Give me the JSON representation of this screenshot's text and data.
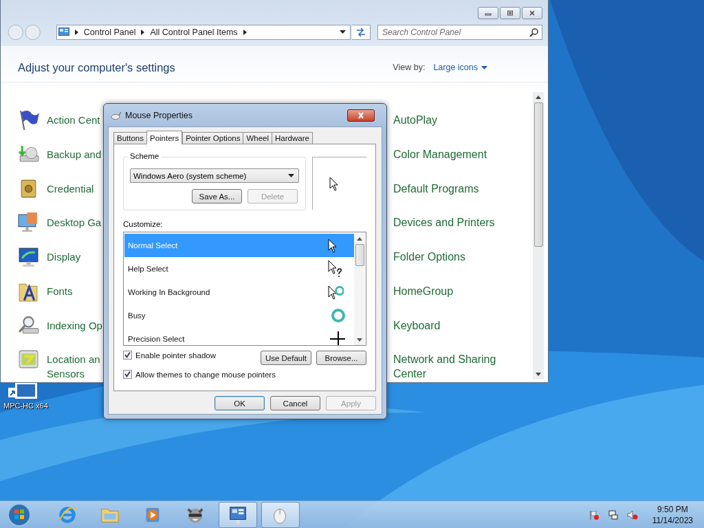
{
  "control_panel": {
    "breadcrumb": [
      "Control Panel",
      "All Control Panel Items"
    ],
    "search": {
      "placeholder": "Search Control Panel"
    },
    "heading": "Adjust your computer's settings",
    "view_by": {
      "label": "View by:",
      "value": "Large icons"
    },
    "items_left": [
      {
        "lines": [
          "Action Cent"
        ]
      },
      {
        "lines": [
          "Backup and"
        ]
      },
      {
        "lines": [
          "Credential"
        ]
      },
      {
        "lines": [
          "Desktop Ga"
        ]
      },
      {
        "lines": [
          "Display"
        ]
      },
      {
        "lines": [
          "Fonts"
        ]
      },
      {
        "lines": [
          "Indexing Op"
        ]
      },
      {
        "lines": [
          "Location an",
          "Sensors"
        ]
      }
    ],
    "items_right": [
      {
        "lines": [
          "AutoPlay"
        ]
      },
      {
        "lines": [
          "Color Management"
        ]
      },
      {
        "lines": [
          "Default Programs"
        ]
      },
      {
        "lines": [
          "Devices and Printers"
        ]
      },
      {
        "lines": [
          "Folder Options"
        ]
      },
      {
        "lines": [
          "HomeGroup"
        ]
      },
      {
        "lines": [
          "Keyboard"
        ]
      },
      {
        "lines": [
          "Network and Sharing",
          "Center"
        ]
      }
    ]
  },
  "desktop_icons": [
    {
      "label": "MPC-HC x64"
    }
  ],
  "dialog": {
    "title": "Mouse Properties",
    "tabs": [
      {
        "label": "Buttons",
        "selected": false
      },
      {
        "label": "Pointers",
        "selected": true
      },
      {
        "label": "Pointer Options",
        "selected": false
      },
      {
        "label": "Wheel",
        "selected": false
      },
      {
        "label": "Hardware",
        "selected": false
      }
    ],
    "scheme": {
      "label": "Scheme",
      "value": "Windows Aero (system scheme)",
      "buttons": [
        {
          "label": "Save As...",
          "disabled": false
        },
        {
          "label": "Delete",
          "disabled": true
        }
      ]
    },
    "customize_label": "Customize:",
    "pointers": [
      {
        "name": "Normal Select",
        "kind": "arrow",
        "selected": true
      },
      {
        "name": "Help Select",
        "kind": "help",
        "selected": false
      },
      {
        "name": "Working In Background",
        "kind": "working",
        "selected": false
      },
      {
        "name": "Busy",
        "kind": "busy",
        "selected": false
      },
      {
        "name": "Precision Select",
        "kind": "cross",
        "selected": false
      }
    ],
    "checkboxes": [
      {
        "label": "Enable pointer shadow",
        "checked": true
      },
      {
        "label": "Allow themes to change mouse pointers",
        "checked": true
      }
    ],
    "list_buttons": [
      "Use Default",
      "Browse..."
    ],
    "footer_buttons": [
      {
        "label": "OK",
        "default": true,
        "disabled": false
      },
      {
        "label": "Cancel",
        "default": false,
        "disabled": false
      },
      {
        "label": "Apply",
        "default": false,
        "disabled": true
      }
    ]
  },
  "taskbar": {
    "apps": [
      {
        "kind": "browser",
        "active": false
      },
      {
        "kind": "explorer",
        "active": false
      },
      {
        "kind": "media",
        "active": false
      },
      {
        "kind": "animal",
        "active": false
      },
      {
        "kind": "control-panel",
        "active": true
      },
      {
        "kind": "mouse",
        "active": true
      }
    ],
    "clock": {
      "time": "9:50 PM",
      "date": "11/14/2023"
    }
  }
}
